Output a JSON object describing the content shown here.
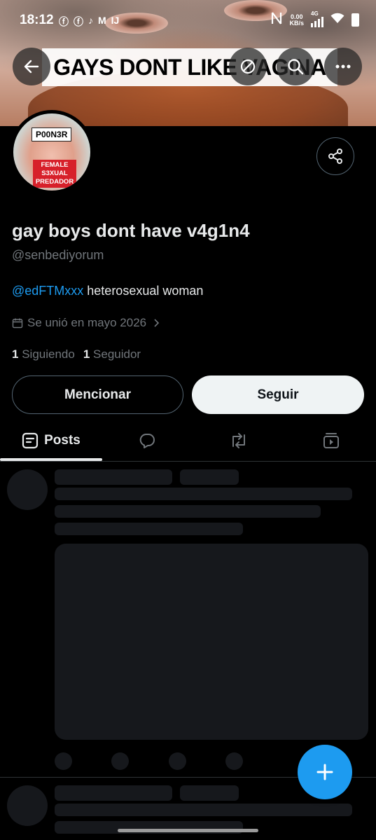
{
  "status_bar": {
    "time": "18:12",
    "net_speed_value": "0.00",
    "net_speed_unit": "KB/s",
    "network": "4G"
  },
  "banner": {
    "caption": "GAYS DONT LIKE VAGINA"
  },
  "avatar": {
    "tag": "P00N3R",
    "label_line1": "FEMALE",
    "label_line2": "S3XUAL",
    "label_line3": "PREDADOR"
  },
  "profile": {
    "name": "gay boys dont have v4g1n4",
    "handle": "@senbediyorum",
    "bio_mention": "@edFTMxxx",
    "bio_text": " heterosexual woman",
    "joined": "Se unió en mayo 2026",
    "following_count": "1",
    "following_label": "Siguiendo",
    "followers_count": "1",
    "followers_label": "Seguidor"
  },
  "actions": {
    "mention_label": "Mencionar",
    "follow_label": "Seguir"
  },
  "tabs": {
    "posts_label": "Posts"
  },
  "colors": {
    "accent": "#1d9bf0",
    "secondary_text": "#71767b",
    "skeleton": "#16181c"
  }
}
